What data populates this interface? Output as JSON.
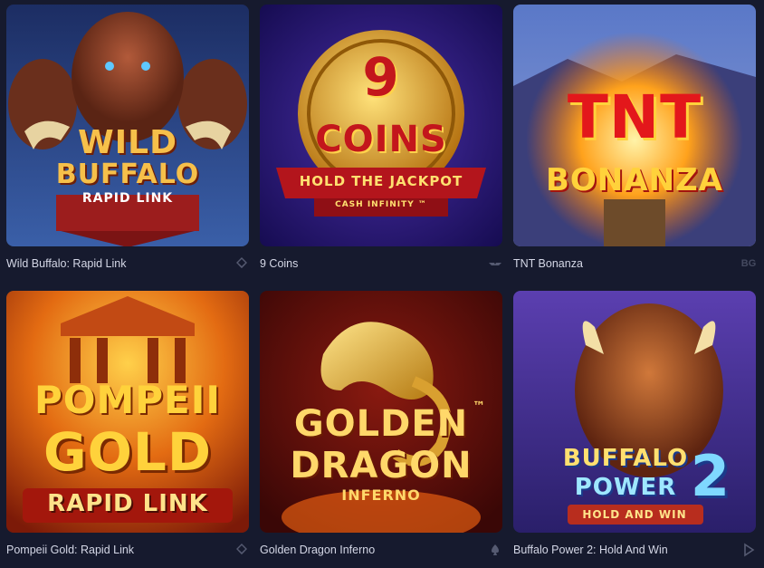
{
  "games": [
    {
      "title": "Wild Buffalo: Rapid Link",
      "logo_line1": "WILD",
      "logo_line2": "BUFFALO",
      "logo_sub": "RAPID LINK",
      "provider_icon": "stacked-diamond-icon"
    },
    {
      "title": "9 Coins",
      "logo_line1": "9",
      "logo_line2": "COINS",
      "logo_sub": "HOLD THE JACKPOT",
      "logo_sub2": "CASH INFINITY ™",
      "provider_icon": "wings-icon"
    },
    {
      "title": "TNT Bonanza",
      "logo_line1": "TNT",
      "logo_line2": "BONANZA",
      "provider_badge": "BG"
    },
    {
      "title": "Pompeii Gold: Rapid Link",
      "logo_line1": "POMPEII",
      "logo_line2": "GOLD",
      "logo_sub": "RAPID LINK",
      "provider_icon": "stacked-diamond-icon"
    },
    {
      "title": "Golden Dragon Inferno",
      "logo_line1": "GOLDEN",
      "logo_line2": "DRAGON",
      "logo_sub": "INFERNO",
      "logo_tm": "™",
      "provider_icon": "spade-icon"
    },
    {
      "title": "Buffalo Power 2: Hold And Win",
      "logo_line1": "BUFFALO",
      "logo_line2": "POWER",
      "logo_num": "2",
      "logo_sub": "HOLD AND WIN",
      "provider_icon": "play-icon"
    }
  ]
}
